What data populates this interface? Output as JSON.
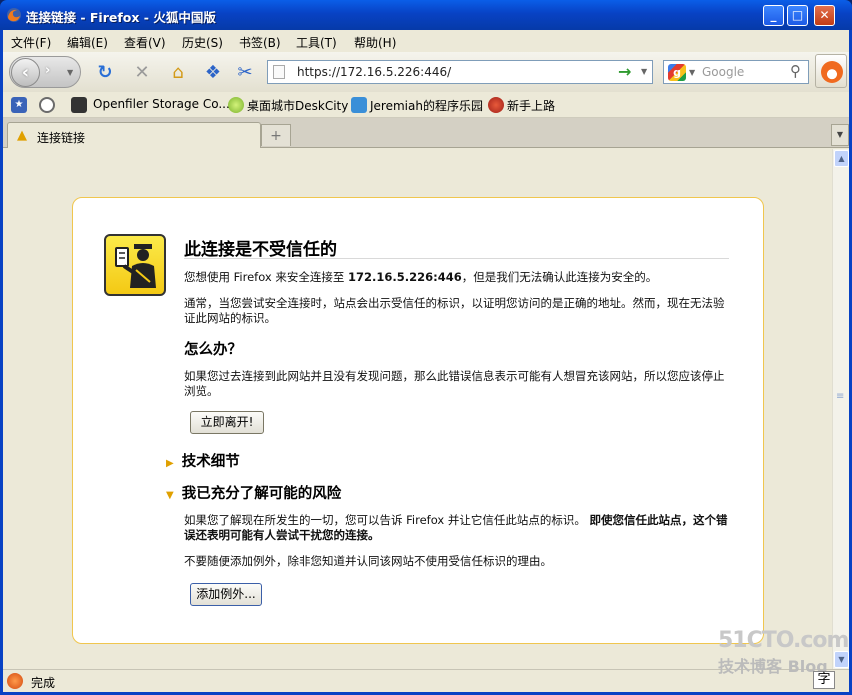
{
  "window": {
    "title": "连接链接 - Firefox - 火狐中国版",
    "min": "_",
    "max": "□",
    "close": "✕"
  },
  "menu": [
    "文件(F)",
    "编辑(E)",
    "查看(V)",
    "历史(S)",
    "书签(B)",
    "工具(T)",
    "帮助(H)"
  ],
  "nav": {
    "url": "https://172.16.5.226:446/",
    "search_placeholder": "Google",
    "back_glyph": "‹",
    "forward_glyph": "›"
  },
  "bookmarks": [
    "Openfiler Storage Co...",
    "桌面城市DeskCity",
    "Jeremiah的程序乐园",
    "新手上路"
  ],
  "tab": {
    "label": "连接链接"
  },
  "error": {
    "title": "此连接是不受信任的",
    "intro_prefix": "您想使用 Firefox 来安全连接至 ",
    "intro_host": "172.16.5.226:446",
    "intro_suffix": "，但是我们无法确认此连接为安全的。",
    "para2": "通常，当您尝试安全连接时，站点会出示受信任的标识，以证明您访问的是正确的地址。然而，现在无法验证此网站的标识。",
    "what_heading": "怎么办？",
    "what_text": "如果您过去连接到此网站并且没有发现问题，那么此错误信息表示可能有人想冒充该网站，所以您应该停止浏览。",
    "leave_button": "立即离开!",
    "tech_heading": "技术细节",
    "risk_heading": "我已充分了解可能的风险",
    "risk_text": "如果您了解现在所发生的一切，您可以告诉 Firefox 并让它信任此站点的标识。",
    "risk_bold": "即使您信任此站点，这个错误还表明可能有人尝试干扰您的连接。",
    "risk_text2": "不要随便添加例外，除非您知道并认同该网站不使用受信任标识的理由。",
    "add_exception_button": "添加例外..."
  },
  "status": {
    "text": "完成"
  },
  "watermark": {
    "line1": "51CTO.com",
    "line2": "技术博客",
    "line3": "Blog"
  },
  "zi_label": "字",
  "colors": {
    "titlebar": "#0842c4",
    "box_border": "#f0c64e",
    "warn": "#e0a000"
  }
}
